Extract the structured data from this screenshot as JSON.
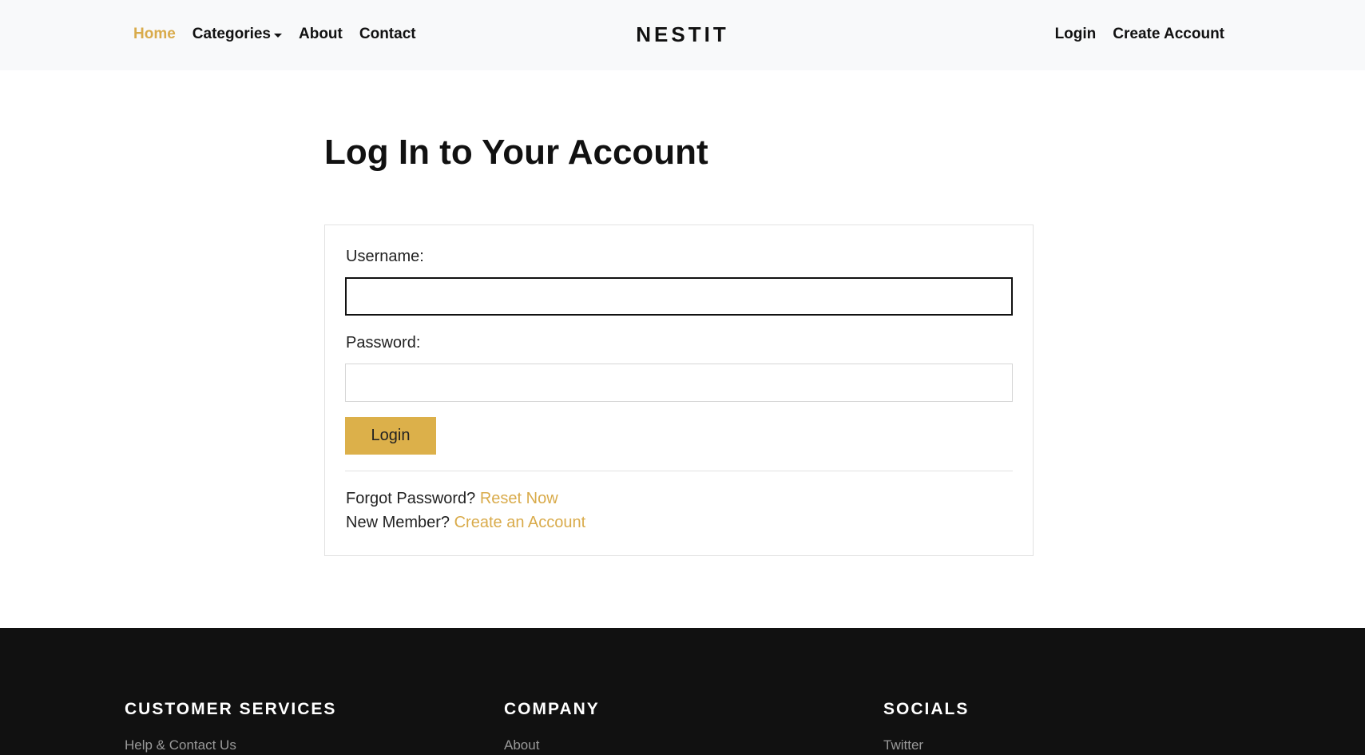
{
  "header": {
    "nav_left": {
      "home": "Home",
      "categories": "Categories",
      "about": "About",
      "contact": "Contact"
    },
    "brand": "NESTIT",
    "nav_right": {
      "login": "Login",
      "create_account": "Create Account"
    }
  },
  "main": {
    "title": "Log In to Your Account",
    "form": {
      "username_label": "Username:",
      "username_value": "",
      "password_label": "Password:",
      "password_value": "",
      "submit_label": "Login"
    },
    "help": {
      "forgot_prefix": "Forgot Password?",
      "forgot_link": "Reset Now",
      "new_member_prefix": "New Member?",
      "new_member_link": "Create an Account"
    }
  },
  "footer": {
    "columns": [
      {
        "heading": "CUSTOMER SERVICES",
        "first_link": "Help & Contact Us"
      },
      {
        "heading": "COMPANY",
        "first_link": "About"
      },
      {
        "heading": "SOCIALS",
        "first_link": "Twitter"
      }
    ]
  },
  "colors": {
    "accent": "#d9ab4b",
    "button": "#dcb04a",
    "header_bg": "#f8f9fa",
    "footer_bg": "#111111"
  }
}
